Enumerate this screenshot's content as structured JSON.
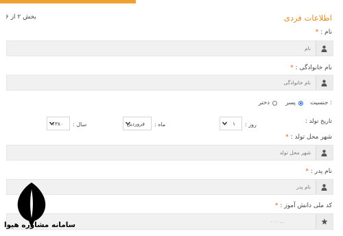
{
  "section": {
    "title": "اطلاعات فردی",
    "step": "بخش ۲ از ۶"
  },
  "fields": {
    "first_name": {
      "label": "نام :",
      "required": "*",
      "placeholder": "نام"
    },
    "last_name": {
      "label": "نام خانوادگی :",
      "required": "*",
      "placeholder": "نام خانوادگی"
    },
    "birth_city": {
      "label": "شهر محل تولد :",
      "required": "*",
      "placeholder": "شهر محل تولد"
    },
    "father_name": {
      "label": "نام پدر :",
      "required": "*",
      "placeholder": "نام پدر"
    },
    "national_code": {
      "label": "کد ملی دانش آموز :",
      "required": "*",
      "value": "۰۰۰ ..."
    }
  },
  "gender": {
    "label": "جنسیت :",
    "options": [
      {
        "label": "پسر",
        "selected": true
      },
      {
        "label": "دختر",
        "selected": false
      }
    ]
  },
  "birth_date": {
    "label": "تاریخ تولد :",
    "day": {
      "label": "روز :",
      "value": "۱"
    },
    "month": {
      "label": "ماه :",
      "value": "فروردین"
    },
    "year": {
      "label": "سال :",
      "value": "۱۳۸۰"
    }
  },
  "watermark": {
    "text": "سامانه مشاوره هیوا"
  },
  "colors": {
    "accent": "#e08a1e",
    "required": "#e05a2a",
    "radio": "#2d6cdf",
    "field_bg": "#f1f1f1"
  }
}
